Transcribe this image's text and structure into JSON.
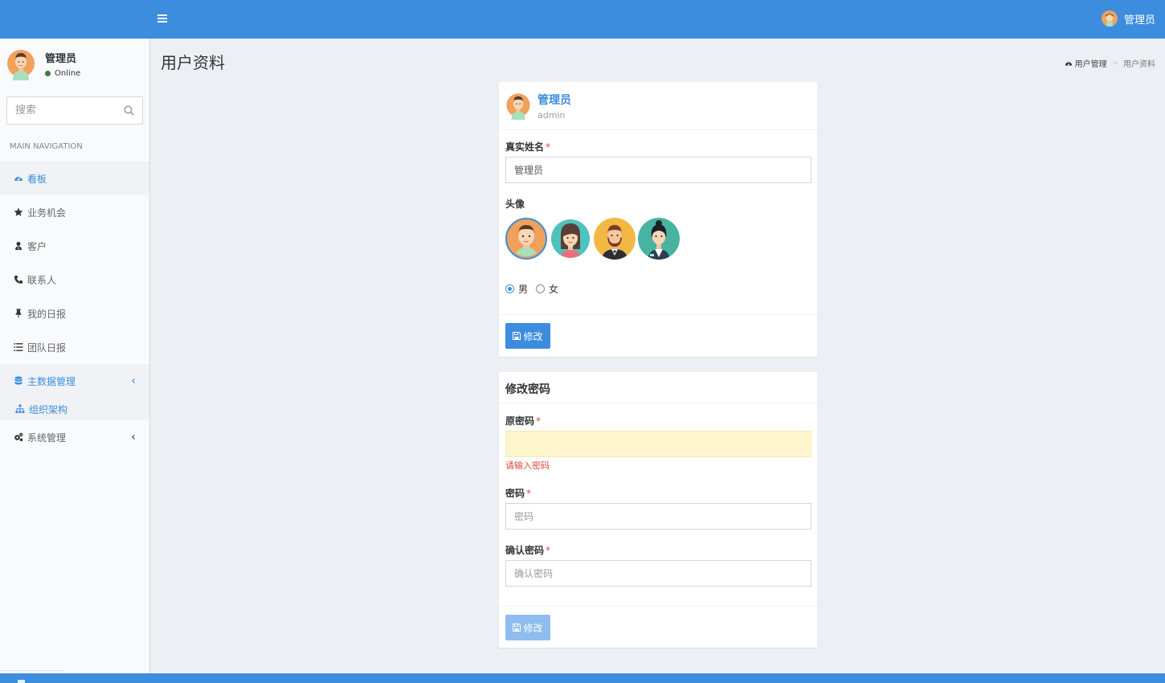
{
  "colors": {
    "brand": "#3c8dde",
    "danger": "#dd4b39",
    "online": "#3d7a3d",
    "warn_bg": "#fef5cc"
  },
  "topbar": {
    "toggle_icon": "hamburger-icon",
    "user_name": "管理员"
  },
  "sidebar": {
    "user": {
      "name": "管理员",
      "status": "Online"
    },
    "search": {
      "placeholder": "搜索",
      "icon": "search-icon"
    },
    "nav_header": "MAIN NAVIGATION",
    "items": [
      {
        "label": "看板",
        "icon": "dashboard-icon",
        "active": true
      },
      {
        "label": "业务机会",
        "icon": "star-icon"
      },
      {
        "label": "客户",
        "icon": "user-tie-icon"
      },
      {
        "label": "联系人",
        "icon": "phone-icon"
      },
      {
        "label": "我的日报",
        "icon": "pin-icon"
      },
      {
        "label": "团队日报",
        "icon": "list-icon"
      },
      {
        "label": "主数据管理",
        "icon": "database-icon",
        "expanded": true
      },
      {
        "label": "组织架构",
        "icon": "sitemap-icon"
      },
      {
        "label": "系统管理",
        "icon": "cogs-icon"
      }
    ]
  },
  "header": {
    "page_title": "用户资料",
    "breadcrumb": [
      "用户管理",
      "用户资料"
    ]
  },
  "profile": {
    "display_name": "管理员",
    "username": "admin",
    "real_name_label": "真实姓名",
    "real_name_value": "管理员",
    "avatar_label": "头像",
    "avatar_options": [
      "male-avatar-1",
      "female-avatar-1",
      "male-avatar-2",
      "female-avatar-2"
    ],
    "selected_avatar": 0,
    "gender_options": [
      "男",
      "女"
    ],
    "selected_gender": "男",
    "submit_label": "修改"
  },
  "password": {
    "title": "修改密码",
    "old_label": "原密码",
    "old_error": "请输入密码",
    "new_label": "密码",
    "new_placeholder": "密码",
    "confirm_label": "确认密码",
    "confirm_placeholder": "确认密码",
    "submit_label": "修改"
  },
  "required_mark": "*"
}
